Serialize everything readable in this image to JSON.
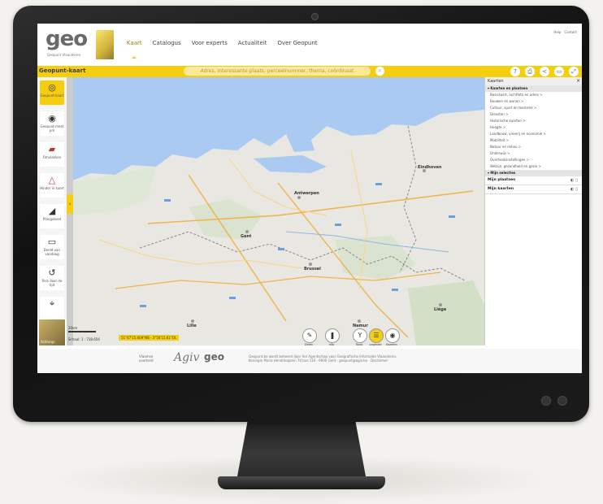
{
  "app": {
    "logo_text": "geo",
    "logo_sub": "Geopunt Vlaanderen",
    "nav": [
      "Kaart",
      "Catalogus",
      "Voor experts",
      "Actualiteit",
      "Over Geopunt"
    ],
    "toplinks": [
      "Help",
      "Contact"
    ]
  },
  "toolbar": {
    "title": "Geopunt-kaart",
    "search_placeholder": "Adres, interessante plaats, perceelnummer, thema, coördinaat"
  },
  "lefttools": [
    {
      "label": "Geopunt-kaart",
      "icon": "target-icon"
    },
    {
      "label": "Geopunt-meet pm",
      "icon": "target-icon"
    },
    {
      "label": "Omvlakken",
      "icon": "shapes-icon"
    },
    {
      "label": "Hinder in kaart",
      "icon": "warning-icon"
    },
    {
      "label": "Plangebied",
      "icon": "layers-icon"
    },
    {
      "label": "Beeld van vandaag",
      "icon": "image-icon"
    },
    {
      "label": "Reis door de tijd",
      "icon": "history-icon"
    },
    {
      "label": "",
      "icon": "pin-icon"
    }
  ],
  "map": {
    "minimap_label": "Achtergr.",
    "scale": "Schaal: 1 : 738.656",
    "scale_bar": "20km",
    "coords": "51°47'15.609\"NB · 3°50'15.61\"OL"
  },
  "bottom_buttons": [
    {
      "label": "Delen",
      "icon": "wrench-icon"
    },
    {
      "label": "Info",
      "icon": "info-icon"
    },
    {
      "label": "Tools",
      "icon": "tools-icon"
    },
    {
      "label": "Legende",
      "icon": "legend-icon"
    },
    {
      "label": "Kaarten",
      "icon": "layers-icon"
    }
  ],
  "rightpanel": {
    "title": "Kaarten",
    "section1": "Kaarten en plaatsen",
    "items": [
      "Basiskaart, luchtfoto en adres >",
      "Bouwen en wonen >",
      "Cultuur, sport en toerisme >",
      "Diensten >",
      "Historische kaarten >",
      "Hoogte >",
      "Landbouw, visserij en economie >",
      "Mobiliteit >",
      "Natuur en milieu >",
      "Onderwijs >",
      "Overheidsinstellingen >",
      "Welzijn, gezondheid en gezin >"
    ],
    "section2": "Mijn selecties",
    "rows": [
      "Mijn plaatsen",
      "Mijn kaarten"
    ]
  },
  "footer": {
    "f1": "Vlaamse overheid",
    "f2": "Agiv",
    "f3": "geo",
    "f4": "Geopunt.be wordt beheerd door het Agentschap voor Geografische Informatie Vlaanderen. Koningin Maria Hendrikaplein 70 bus 110 · 9000 Gent · geopunt@agiv.be · Disclaimer"
  },
  "map_labels": [
    "Antwerpen",
    "Brussel",
    "Gent",
    "Eindhoven",
    "Lille",
    "Liège",
    "Namur"
  ]
}
